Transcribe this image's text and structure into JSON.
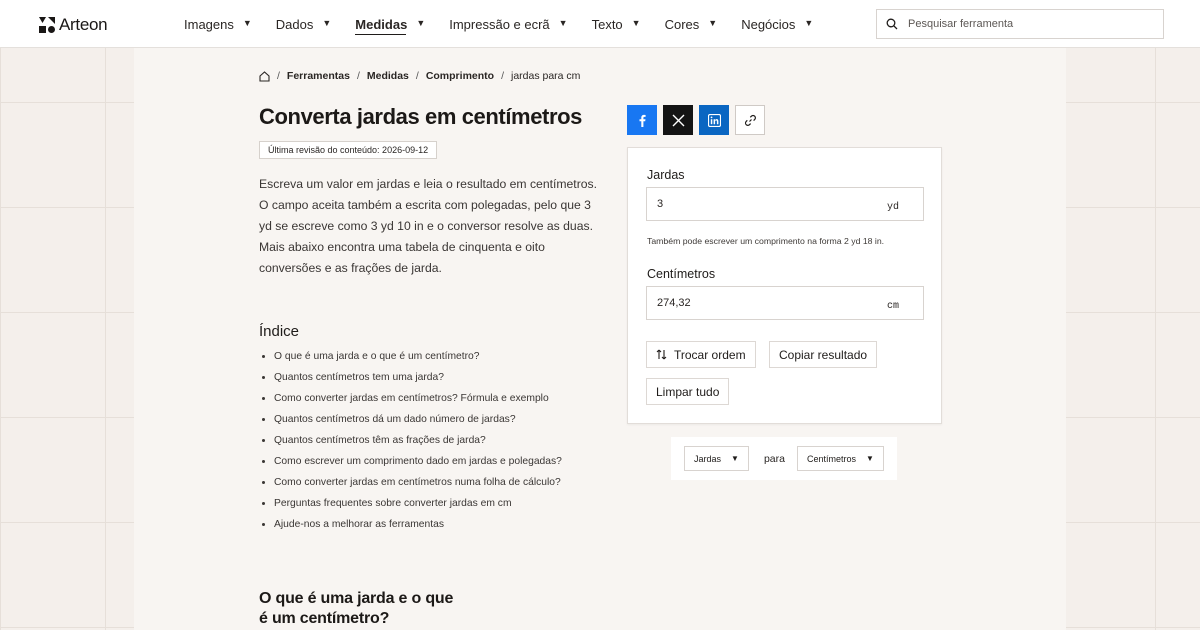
{
  "brand": {
    "name": "Arteon"
  },
  "nav": [
    {
      "label": "Imagens",
      "active": false
    },
    {
      "label": "Dados",
      "active": false
    },
    {
      "label": "Medidas",
      "active": true
    },
    {
      "label": "Impressão e ecrã",
      "active": false
    },
    {
      "label": "Texto",
      "active": false
    },
    {
      "label": "Cores",
      "active": false
    },
    {
      "label": "Negócios",
      "active": false
    }
  ],
  "search": {
    "placeholder": "Pesquisar ferramenta"
  },
  "breadcrumb": [
    "Ferramentas",
    "Medidas",
    "Comprimento",
    "jardas para cm"
  ],
  "page": {
    "title": "Converta jardas em centímetros",
    "revision": "Última revisão do conteúdo: 2026-09-12",
    "intro": "Escreva um valor em jardas e leia o resultado em centímetros. O campo aceita também a escrita com polegadas, pelo que 3 yd se escreve como 3 yd 10 in e o conversor resolve as duas. Mais abaixo encontra uma tabela de cinquenta e oito conversões e as frações de jarda.",
    "toc_title": "Índice",
    "toc": [
      "O que é uma jarda e o que é um centímetro?",
      "Quantos centímetros tem uma jarda?",
      "Como converter jardas em centímetros? Fórmula e exemplo",
      "Quantos centímetros dá um dado número de jardas?",
      "Quantos centímetros têm as frações de jarda?",
      "Como escrever um comprimento dado em jardas e polegadas?",
      "Como converter jardas em centímetros numa folha de cálculo?",
      "Perguntas frequentes sobre converter jardas em cm",
      "Ajude-nos a melhorar as ferramentas"
    ],
    "section_title": "O que é uma jarda e o que é um centímetro?"
  },
  "converter": {
    "from_label": "Jardas",
    "from_value": "3",
    "from_unit": "yd",
    "hint": "Também pode escrever um comprimento na forma 2 yd 18 in.",
    "to_label": "Centímetros",
    "to_value": "274,32",
    "to_unit": "cm",
    "swap_label": "Trocar ordem",
    "copy_label": "Copiar resultado",
    "clear_label": "Limpar tudo"
  },
  "unit_select": {
    "from": "Jardas",
    "connector": "para",
    "to": "Centímetros"
  },
  "colors": {
    "facebook": "#1877f2",
    "x": "#141414",
    "linkedin": "#0a66c2"
  }
}
